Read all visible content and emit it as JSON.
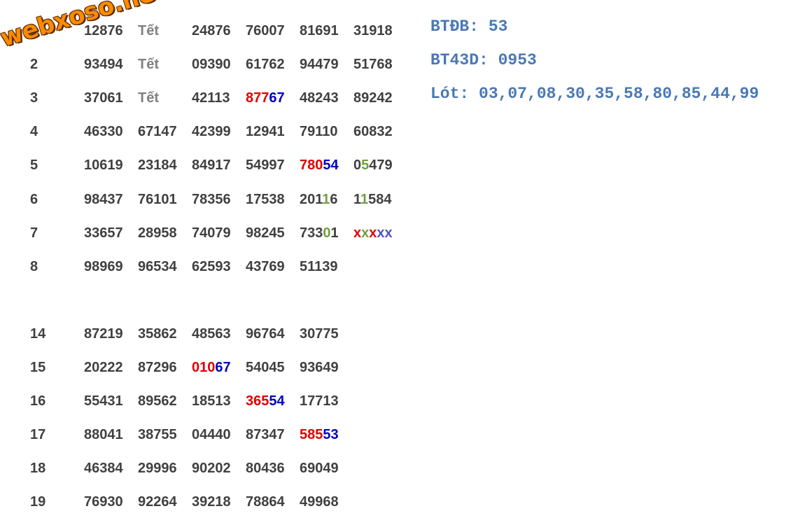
{
  "watermark": "webxoso.net",
  "info": {
    "btdb": "BTĐB: 53",
    "bt43d": "BT43D: 0953",
    "lot": "Lót: 03,07,08,30,35,58,80,85,44,99"
  },
  "rows": [
    {
      "idx": "1",
      "cells": [
        [
          [
            "n",
            "1"
          ],
          [
            "n",
            "2876"
          ]
        ],
        [
          [
            "tet",
            "Tết"
          ]
        ],
        [
          [
            "n",
            "24876"
          ]
        ],
        [
          [
            "n",
            "76007"
          ]
        ],
        [
          [
            "n",
            "81691"
          ]
        ],
        [
          [
            "n",
            "31918"
          ]
        ]
      ]
    },
    {
      "idx": "2",
      "cells": [
        [
          [
            "n",
            "93494"
          ]
        ],
        [
          [
            "tet",
            "Tết"
          ]
        ],
        [
          [
            "n",
            "09390"
          ]
        ],
        [
          [
            "n",
            "61762"
          ]
        ],
        [
          [
            "n",
            "94479"
          ]
        ],
        [
          [
            "n",
            "51768"
          ]
        ]
      ]
    },
    {
      "idx": "3",
      "cells": [
        [
          [
            "n",
            "37061"
          ]
        ],
        [
          [
            "tet",
            "Tết"
          ]
        ],
        [
          [
            "n",
            "42113"
          ]
        ],
        [
          [
            "r",
            "877"
          ],
          [
            "b",
            "67"
          ]
        ],
        [
          [
            "n",
            "48243"
          ]
        ],
        [
          [
            "n",
            "89242"
          ]
        ]
      ]
    },
    {
      "idx": "4",
      "cells": [
        [
          [
            "n",
            "46330"
          ]
        ],
        [
          [
            "n",
            "67147"
          ]
        ],
        [
          [
            "n",
            "42399"
          ]
        ],
        [
          [
            "n",
            "12941"
          ]
        ],
        [
          [
            "n",
            "79110"
          ]
        ],
        [
          [
            "n",
            "60832"
          ]
        ]
      ]
    },
    {
      "idx": "5",
      "cells": [
        [
          [
            "n",
            "10619"
          ]
        ],
        [
          [
            "n",
            "23184"
          ]
        ],
        [
          [
            "n",
            "84917"
          ]
        ],
        [
          [
            "n",
            "54997"
          ]
        ],
        [
          [
            "r",
            "780"
          ],
          [
            "b",
            "54"
          ]
        ],
        [
          [
            "n",
            "0"
          ],
          [
            "g",
            "5"
          ],
          [
            "n",
            "479"
          ]
        ]
      ]
    },
    {
      "idx": "6",
      "cells": [
        [
          [
            "n",
            "98437"
          ]
        ],
        [
          [
            "n",
            "76101"
          ]
        ],
        [
          [
            "n",
            "78356"
          ]
        ],
        [
          [
            "n",
            "17538"
          ]
        ],
        [
          [
            "n",
            "201"
          ],
          [
            "g",
            "1"
          ],
          [
            "n",
            "6"
          ]
        ],
        [
          [
            "n",
            "1"
          ],
          [
            "g",
            "1"
          ],
          [
            "n",
            "584"
          ]
        ]
      ]
    },
    {
      "idx": "7",
      "cells": [
        [
          [
            "n",
            "33657"
          ]
        ],
        [
          [
            "n",
            "28958"
          ]
        ],
        [
          [
            "n",
            "74079"
          ]
        ],
        [
          [
            "n",
            "98245"
          ]
        ],
        [
          [
            "n",
            "733"
          ],
          [
            "g",
            "0"
          ],
          [
            "n",
            "1"
          ]
        ],
        [
          [
            "r",
            "x"
          ],
          [
            "g",
            "x"
          ],
          [
            "r",
            "x"
          ],
          [
            "pb",
            "xx"
          ]
        ]
      ]
    },
    {
      "idx": "8",
      "cells": [
        [
          [
            "n",
            "98969"
          ]
        ],
        [
          [
            "n",
            "96534"
          ]
        ],
        [
          [
            "n",
            "62593"
          ]
        ],
        [
          [
            "n",
            "43769"
          ]
        ],
        [
          [
            "n",
            "51139"
          ]
        ]
      ]
    },
    {
      "idx": "14",
      "cells": [
        [
          [
            "n",
            "87219"
          ]
        ],
        [
          [
            "n",
            "35862"
          ]
        ],
        [
          [
            "n",
            "48563"
          ]
        ],
        [
          [
            "n",
            "96764"
          ]
        ],
        [
          [
            "n",
            "30775"
          ]
        ]
      ]
    },
    {
      "idx": "15",
      "cells": [
        [
          [
            "n",
            "20222"
          ]
        ],
        [
          [
            "n",
            "87296"
          ]
        ],
        [
          [
            "r",
            "010"
          ],
          [
            "b",
            "67"
          ]
        ],
        [
          [
            "n",
            "54045"
          ]
        ],
        [
          [
            "n",
            "93649"
          ]
        ]
      ]
    },
    {
      "idx": "16",
      "cells": [
        [
          [
            "n",
            "55431"
          ]
        ],
        [
          [
            "n",
            "89562"
          ]
        ],
        [
          [
            "n",
            "18513"
          ]
        ],
        [
          [
            "r",
            "365"
          ],
          [
            "b",
            "54"
          ]
        ],
        [
          [
            "n",
            "17713"
          ]
        ]
      ]
    },
    {
      "idx": "17",
      "cells": [
        [
          [
            "n",
            "88041"
          ]
        ],
        [
          [
            "n",
            "38755"
          ]
        ],
        [
          [
            "n",
            "04440"
          ]
        ],
        [
          [
            "n",
            "87347"
          ]
        ],
        [
          [
            "r",
            "585"
          ],
          [
            "b",
            "53"
          ]
        ]
      ]
    },
    {
      "idx": "18",
      "cells": [
        [
          [
            "n",
            "46384"
          ]
        ],
        [
          [
            "n",
            "29996"
          ]
        ],
        [
          [
            "n",
            "90202"
          ]
        ],
        [
          [
            "n",
            "80436"
          ]
        ],
        [
          [
            "n",
            "69049"
          ]
        ]
      ]
    },
    {
      "idx": "19",
      "cells": [
        [
          [
            "n",
            "76930"
          ]
        ],
        [
          [
            "n",
            "92264"
          ]
        ],
        [
          [
            "n",
            "39218"
          ]
        ],
        [
          [
            "n",
            "78864"
          ]
        ],
        [
          [
            "n",
            "49968"
          ]
        ]
      ]
    }
  ]
}
